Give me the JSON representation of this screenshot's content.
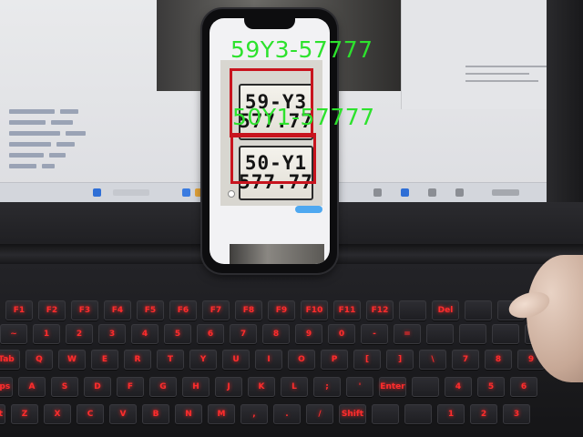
{
  "detections": [
    {
      "label": "59Y3-57777",
      "plate_line1": "59-Y3",
      "plate_line2": "577.77",
      "box_color": "#c8141e",
      "label_color": "#2de22d"
    },
    {
      "label": "50Y1-57777",
      "plate_line1": "50-Y1",
      "plate_line2": "577.77",
      "box_color": "#c8141e",
      "label_color": "#2de22d"
    }
  ],
  "keyboard": {
    "rows": [
      [
        "F1",
        "F2",
        "F3",
        "F4",
        "F5",
        "F6",
        "F7",
        "F8",
        "F9",
        "F10",
        "F11",
        "F12",
        "",
        "Del",
        "",
        "",
        ""
      ],
      [
        "~",
        "1",
        "2",
        "3",
        "4",
        "5",
        "6",
        "7",
        "8",
        "9",
        "0",
        "-",
        "=",
        "",
        "",
        "",
        ""
      ],
      [
        "Tab",
        "Q",
        "W",
        "E",
        "R",
        "T",
        "Y",
        "U",
        "I",
        "O",
        "P",
        "[",
        "]",
        "\\",
        "7",
        "8",
        "9"
      ],
      [
        "Caps",
        "A",
        "S",
        "D",
        "F",
        "G",
        "H",
        "J",
        "K",
        "L",
        ";",
        "'",
        "Enter",
        "",
        "4",
        "5",
        "6"
      ],
      [
        "Shift",
        "Z",
        "X",
        "C",
        "V",
        "B",
        "N",
        "M",
        ",",
        ".",
        "/",
        "Shift",
        "",
        "",
        "1",
        "2",
        "3"
      ]
    ],
    "backlight_color": "#ff2d2d"
  }
}
